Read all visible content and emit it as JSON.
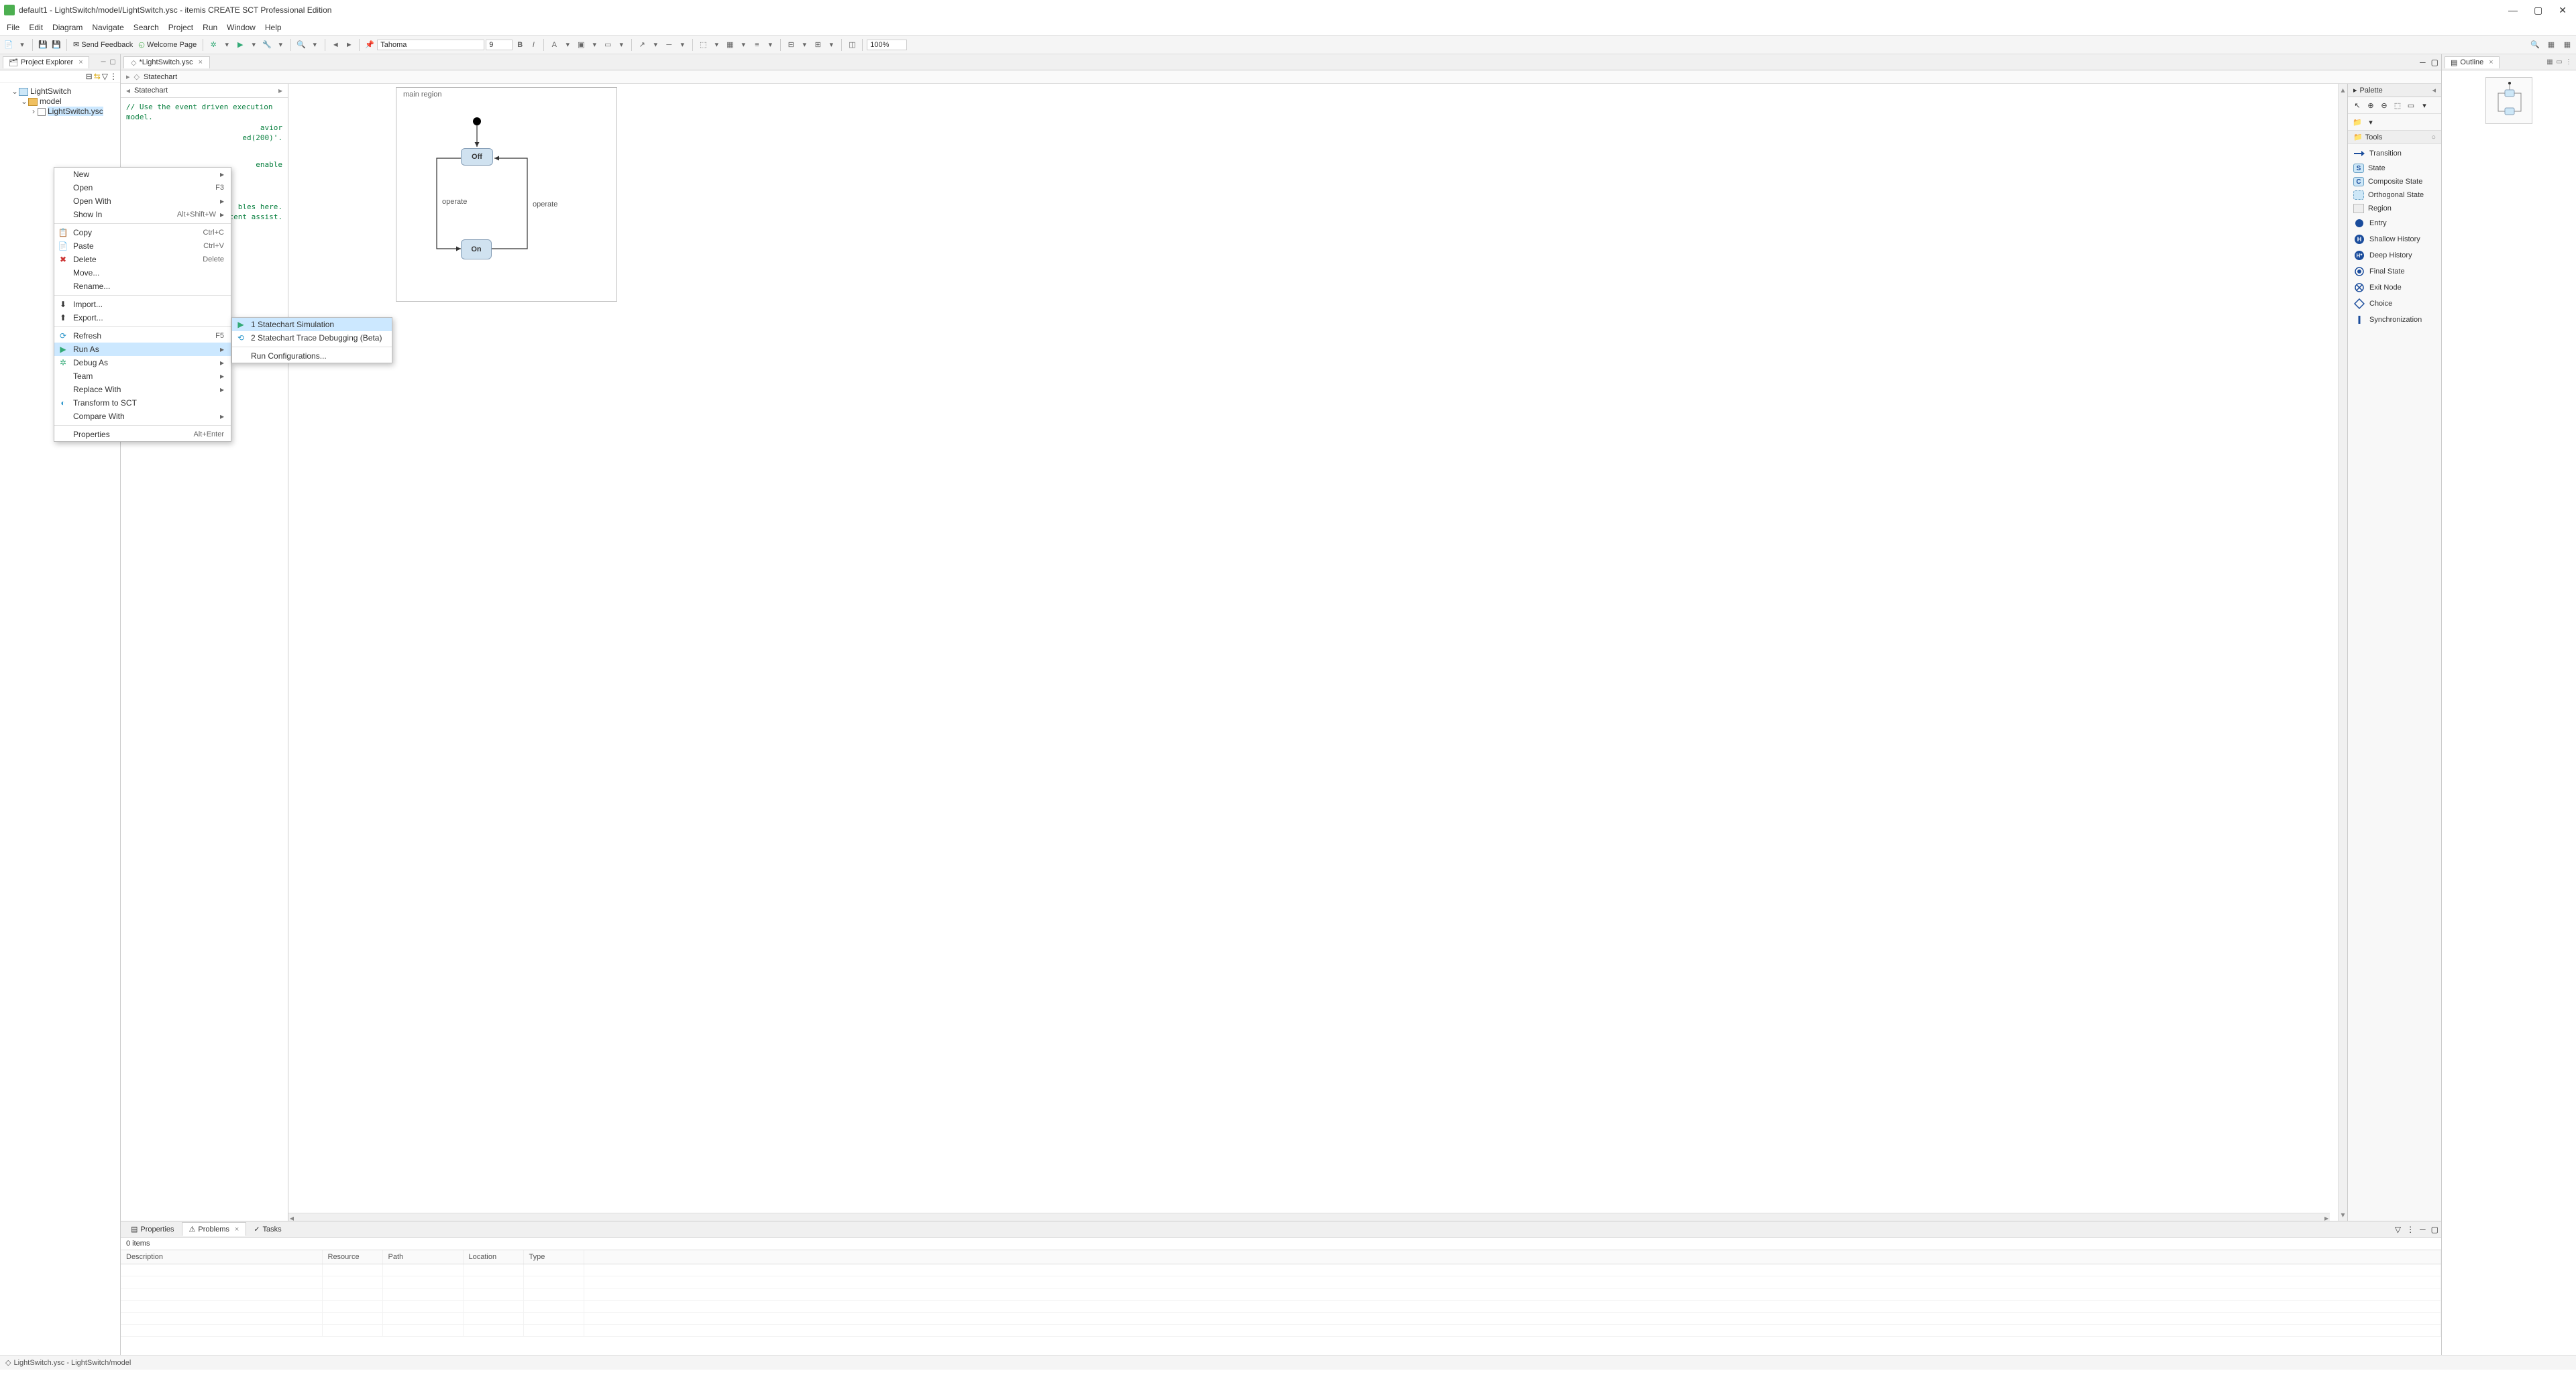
{
  "titlebar": {
    "title": "default1 - LightSwitch/model/LightSwitch.ysc - itemis CREATE SCT Professional Edition"
  },
  "menubar": [
    "File",
    "Edit",
    "Diagram",
    "Navigate",
    "Search",
    "Project",
    "Run",
    "Window",
    "Help"
  ],
  "toolbar": {
    "send_feedback": "Send Feedback",
    "welcome_page": "Welcome Page",
    "font": "Tahoma",
    "size": "9",
    "zoom": "100%"
  },
  "project_explorer": {
    "tab": "Project Explorer",
    "tree": {
      "root": "LightSwitch",
      "folder": "model",
      "file": "LightSwitch.ysc"
    }
  },
  "editor": {
    "tab": "*LightSwitch.ysc",
    "breadcrumb": "Statechart",
    "statechart_label": "Statechart",
    "code_comment1": "// Use the event driven execution model.",
    "code_comment2": "avior",
    "code_comment3": "ed(200)'.",
    "code_comment4": "enable",
    "code_comment5": "bles here.",
    "code_comment6": "ontent assist."
  },
  "diagram": {
    "region_label": "main region",
    "state_off": "Off",
    "state_on": "On",
    "trans_left": "operate",
    "trans_right": "operate"
  },
  "palette": {
    "title": "Palette",
    "tools_label": "Tools",
    "items": [
      "Transition",
      "State",
      "Composite State",
      "Orthogonal State",
      "Region",
      "Entry",
      "Shallow History",
      "Deep History",
      "Final State",
      "Exit Node",
      "Choice",
      "Synchronization"
    ]
  },
  "outline": {
    "tab": "Outline"
  },
  "context_menu": {
    "items": [
      {
        "label": "New",
        "arrow": true
      },
      {
        "label": "Open",
        "shortcut": "F3"
      },
      {
        "label": "Open With",
        "arrow": true
      },
      {
        "label": "Show In",
        "shortcut": "Alt+Shift+W",
        "arrow": true
      },
      {
        "sep": true
      },
      {
        "label": "Copy",
        "shortcut": "Ctrl+C",
        "icon": "copy"
      },
      {
        "label": "Paste",
        "shortcut": "Ctrl+V",
        "icon": "paste"
      },
      {
        "label": "Delete",
        "shortcut": "Delete",
        "icon": "delete"
      },
      {
        "label": "Move..."
      },
      {
        "label": "Rename..."
      },
      {
        "sep": true
      },
      {
        "label": "Import...",
        "icon": "import"
      },
      {
        "label": "Export...",
        "icon": "export"
      },
      {
        "sep": true
      },
      {
        "label": "Refresh",
        "shortcut": "F5",
        "icon": "refresh"
      },
      {
        "label": "Run As",
        "arrow": true,
        "icon": "run",
        "highlight": true
      },
      {
        "label": "Debug As",
        "arrow": true,
        "icon": "debug"
      },
      {
        "label": "Team",
        "arrow": true
      },
      {
        "label": "Replace With",
        "arrow": true
      },
      {
        "label": "Transform to SCT",
        "icon": "transform"
      },
      {
        "label": "Compare With",
        "arrow": true
      },
      {
        "sep": true
      },
      {
        "label": "Properties",
        "shortcut": "Alt+Enter"
      }
    ]
  },
  "submenu": {
    "items": [
      {
        "label": "1 Statechart Simulation",
        "icon": "run",
        "highlight": true
      },
      {
        "label": "2 Statechart Trace Debugging (Beta)",
        "icon": "trace"
      },
      {
        "sep": true
      },
      {
        "label": "Run Configurations..."
      }
    ]
  },
  "bottom": {
    "tabs": {
      "properties": "Properties",
      "problems": "Problems",
      "tasks": "Tasks"
    },
    "items_count": "0 items",
    "columns": [
      "Description",
      "Resource",
      "Path",
      "Location",
      "Type"
    ]
  },
  "statusbar": {
    "text": "LightSwitch.ysc - LightSwitch/model"
  }
}
